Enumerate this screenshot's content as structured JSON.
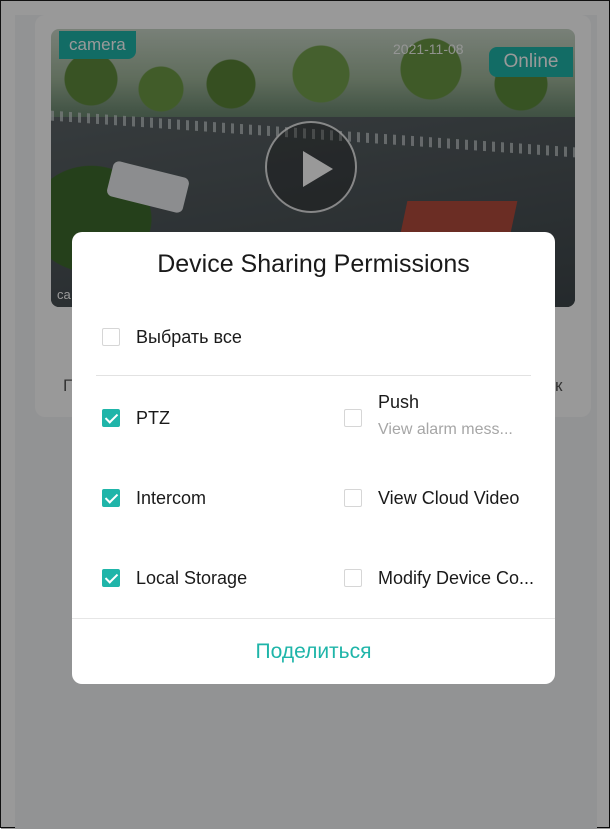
{
  "background": {
    "camera_tag": "camera",
    "status": "Online",
    "timestamp": "2021-11-08",
    "camera_label_short": "ca",
    "card_left_fragment": "Г",
    "card_right_fragment": "к"
  },
  "dialog": {
    "title": "Device Sharing Permissions",
    "select_all": {
      "label": "Выбрать все",
      "checked": false
    },
    "permissions": [
      {
        "label": "PTZ",
        "checked": true
      },
      {
        "label": "Push",
        "subtitle": "View alarm mess...",
        "checked": false
      },
      {
        "label": "Intercom",
        "checked": true
      },
      {
        "label": "View Cloud Video",
        "checked": false
      },
      {
        "label": "Local Storage",
        "checked": true
      },
      {
        "label": "Modify Device Co...",
        "checked": false
      }
    ],
    "share_button": "Поделиться"
  },
  "colors": {
    "accent": "#1fb5a9",
    "overlay": "rgba(0,0,0,0.40)"
  }
}
